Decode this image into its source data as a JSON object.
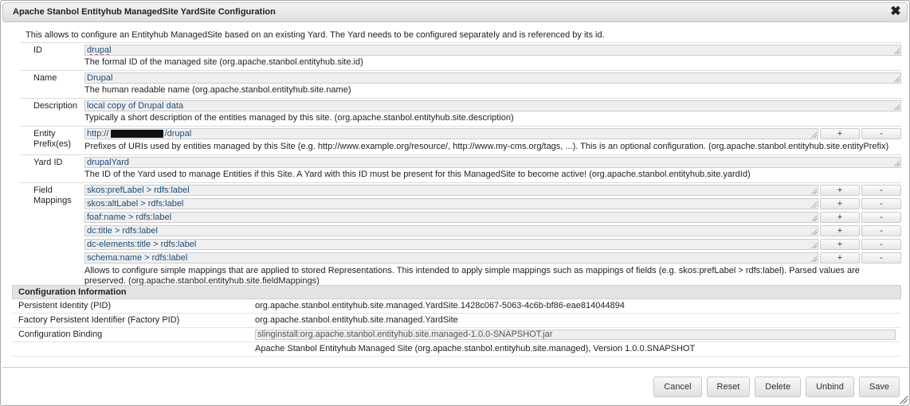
{
  "dialog": {
    "title": "Apache Stanbol Entityhub ManagedSite YardSite Configuration",
    "close_glyph": "✖",
    "intro": "This allows to configure an Entityhub ManagedSite based on an existing Yard. The Yard needs to be configured separately and is referenced by its id."
  },
  "fields": {
    "id": {
      "label": "ID",
      "value": "drupal",
      "desc": "The formal ID of the managed site (org.apache.stanbol.entityhub.site.id)"
    },
    "name": {
      "label": "Name",
      "value": "Drupal",
      "desc": "The human readable name (org.apache.stanbol.entityhub.site.name)"
    },
    "description": {
      "label": "Description",
      "value": "local copy of Drupal data",
      "desc": "Typically a short description of the entities managed by this site. (org.apache.stanbol.entityhub.site.description)"
    },
    "prefix": {
      "label": "Entity Prefix(es)",
      "value_start": "http://",
      "value_end": "/drupal",
      "desc": "Prefixes of URIs used by entities managed by this Site (e.g. http://www.example.org/resource/, http://www.my-cms.org/tags, ...). This is an optional configuration. (org.apache.stanbol.entityhub.site.entityPrefix)"
    },
    "yard": {
      "label": "Yard ID",
      "value": "drupalYard",
      "desc": "The ID of the Yard used to manage Entities if this Site. A Yard with this ID must be present for this ManagedSite to become active! (org.apache.stanbol.entityhub.site.yardId)"
    },
    "mappings": {
      "label": "Field Mappings",
      "values": [
        "skos:prefLabel > rdfs:label",
        "skos:altLabel > rdfs:label",
        "foaf:name > rdfs:label",
        "dc:title > rdfs:label",
        "dc-elements:title > rdfs:label",
        "schema:name > rdfs:label"
      ],
      "desc": "Allows to configure simple mappings that are applied to stored Representations. This intended to apply simple mappings such as mappings of fields (e.g. skos:prefLabel > rdfs:label). Parsed values are preserved. (org.apache.stanbol.entityhub.site.fieldMappings)"
    },
    "plus": "+",
    "minus": "-"
  },
  "config_info": {
    "header": "Configuration Information",
    "pid_label": "Persistent Identity (PID)",
    "pid_value": "org.apache.stanbol.entityhub.site.managed.YardSite.1428c067-5063-4c6b-bf86-eae814044894",
    "factory_label": "Factory Persistent Identifier (Factory PID)",
    "factory_value": "org.apache.stanbol.entityhub.site.managed.YardSite",
    "binding_label": "Configuration Binding",
    "binding_value": "slinginstall:org.apache.stanbol.entityhub.site.managed-1.0.0-SNAPSHOT.jar",
    "bundle_value": "Apache Stanbol Entityhub Managed Site (org.apache.stanbol.entityhub.site.managed), Version 1.0.0.SNAPSHOT"
  },
  "buttons": {
    "cancel": "Cancel",
    "reset": "Reset",
    "delete": "Delete",
    "unbind": "Unbind",
    "save": "Save"
  }
}
